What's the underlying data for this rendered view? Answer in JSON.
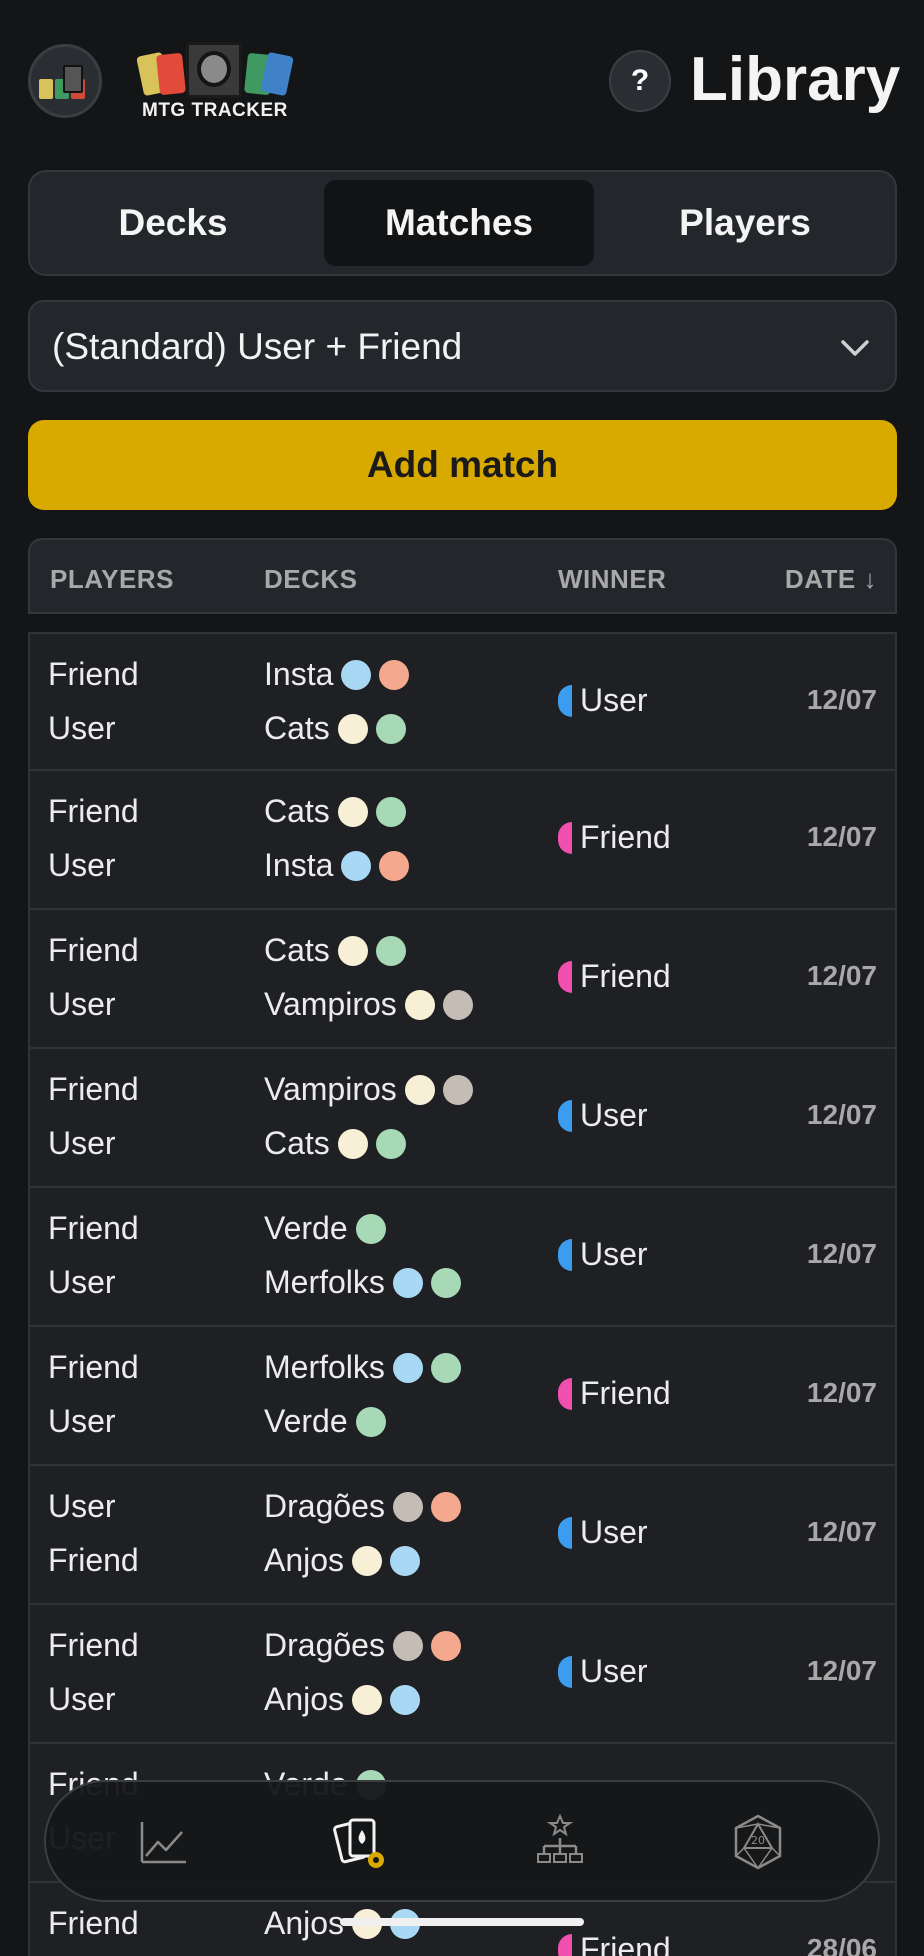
{
  "header": {
    "logo_text": "MTG TRACKER",
    "help_label": "?",
    "title": "Library"
  },
  "tabs": [
    {
      "label": "Decks",
      "active": false
    },
    {
      "label": "Matches",
      "active": true
    },
    {
      "label": "Players",
      "active": false
    }
  ],
  "filter": {
    "selected": "(Standard) User + Friend"
  },
  "add_button": {
    "label": "Add match"
  },
  "table": {
    "headers": {
      "players": "PLAYERS",
      "decks": "DECKS",
      "winner": "WINNER",
      "date": "DATE ↓"
    },
    "rows": [
      {
        "p1": "Friend",
        "p2": "User",
        "d1": "Insta",
        "d1_mana": [
          "U",
          "R"
        ],
        "d2": "Cats",
        "d2_mana": [
          "W",
          "G"
        ],
        "winner": "User",
        "winner_color": "#3b9cf0",
        "date": "12/07"
      },
      {
        "p1": "Friend",
        "p2": "User",
        "d1": "Cats",
        "d1_mana": [
          "W",
          "G"
        ],
        "d2": "Insta",
        "d2_mana": [
          "U",
          "R"
        ],
        "winner": "Friend",
        "winner_color": "#f04fb0",
        "date": "12/07"
      },
      {
        "p1": "Friend",
        "p2": "User",
        "d1": "Cats",
        "d1_mana": [
          "W",
          "G"
        ],
        "d2": "Vampiros",
        "d2_mana": [
          "W",
          "B"
        ],
        "winner": "Friend",
        "winner_color": "#f04fb0",
        "date": "12/07"
      },
      {
        "p1": "Friend",
        "p2": "User",
        "d1": "Vampiros",
        "d1_mana": [
          "W",
          "B"
        ],
        "d2": "Cats",
        "d2_mana": [
          "W",
          "G"
        ],
        "winner": "User",
        "winner_color": "#3b9cf0",
        "date": "12/07"
      },
      {
        "p1": "Friend",
        "p2": "User",
        "d1": "Verde",
        "d1_mana": [
          "G"
        ],
        "d2": "Merfolks",
        "d2_mana": [
          "U",
          "G"
        ],
        "winner": "User",
        "winner_color": "#3b9cf0",
        "date": "12/07"
      },
      {
        "p1": "Friend",
        "p2": "User",
        "d1": "Merfolks",
        "d1_mana": [
          "U",
          "G"
        ],
        "d2": "Verde",
        "d2_mana": [
          "G"
        ],
        "winner": "Friend",
        "winner_color": "#f04fb0",
        "date": "12/07"
      },
      {
        "p1": "User",
        "p2": "Friend",
        "d1": "Dragões",
        "d1_mana": [
          "B",
          "R"
        ],
        "d2": "Anjos",
        "d2_mana": [
          "W",
          "U"
        ],
        "winner": "User",
        "winner_color": "#3b9cf0",
        "date": "12/07"
      },
      {
        "p1": "Friend",
        "p2": "User",
        "d1": "Dragões",
        "d1_mana": [
          "B",
          "R"
        ],
        "d2": "Anjos",
        "d2_mana": [
          "W",
          "U"
        ],
        "winner": "User",
        "winner_color": "#3b9cf0",
        "date": "12/07"
      },
      {
        "p1": "Friend",
        "p2": "User",
        "d1": "Verde",
        "d1_mana": [
          "G"
        ],
        "d2": "",
        "d2_mana": [],
        "winner": "",
        "winner_color": "#3b9cf0",
        "date": ""
      },
      {
        "p1": "Friend",
        "p2": "",
        "d1": "Anjos",
        "d1_mana": [
          "W",
          "U"
        ],
        "d2": "",
        "d2_mana": [],
        "winner": "Friend",
        "winner_color": "#f04fb0",
        "date": "28/06"
      }
    ]
  },
  "bottom_nav": [
    {
      "icon": "stats-chart-icon",
      "active": false
    },
    {
      "icon": "deck-library-icon",
      "active": true
    },
    {
      "icon": "tournament-bracket-icon",
      "active": false
    },
    {
      "icon": "d20-dice-icon",
      "active": false
    }
  ],
  "colors": {
    "accent": "#d8aa00",
    "user": "#3b9cf0",
    "friend": "#f04fb0",
    "background": "#141517"
  }
}
